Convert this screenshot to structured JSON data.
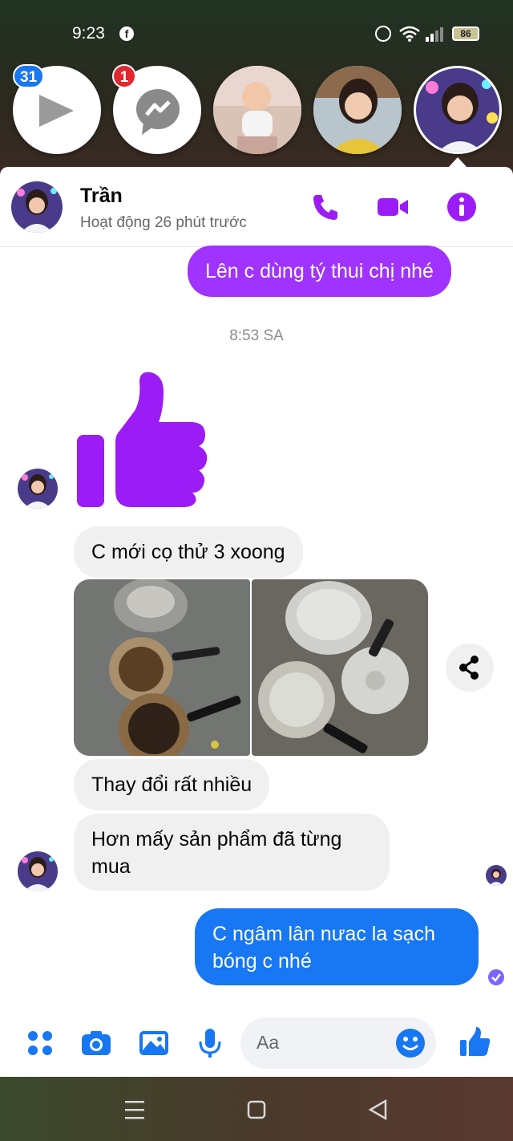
{
  "status_bar": {
    "time": "9:23",
    "fb_glyph": "f",
    "battery": "86",
    "icons": [
      "facebook-icon",
      "alarm-icon",
      "wifi-icon",
      "signal-icon",
      "battery-icon"
    ]
  },
  "chat_heads": {
    "badges": {
      "video": "31",
      "messenger": "1"
    },
    "icons": [
      "play-icon",
      "messenger-icon"
    ]
  },
  "header": {
    "name": "Trần",
    "status": "Hoạt động 26 phút trước",
    "icons": [
      "phone-icon",
      "video-call-icon",
      "info-icon"
    ]
  },
  "messages": {
    "out_1": "Lên c dùng tý thui chị nhé",
    "timestamp": "8:53 SA",
    "in_1": "C mới cọ thử 3 xoong",
    "in_2": "Thay đổi rất nhiều",
    "in_3": "Hơn mấy sản phẩm đã từng mua",
    "out_2": "C ngâm lân nưac la sạch bóng c nhé"
  },
  "composer": {
    "placeholder": "Aa",
    "icons": [
      "menu-icon",
      "camera-icon",
      "image-icon",
      "microphone-icon",
      "emoji-icon",
      "like-icon"
    ]
  },
  "colors": {
    "purple": "#a033ff",
    "blue": "#1877f2",
    "incoming": "#f0f0f0",
    "accent_icon": "#9b1cf5"
  }
}
